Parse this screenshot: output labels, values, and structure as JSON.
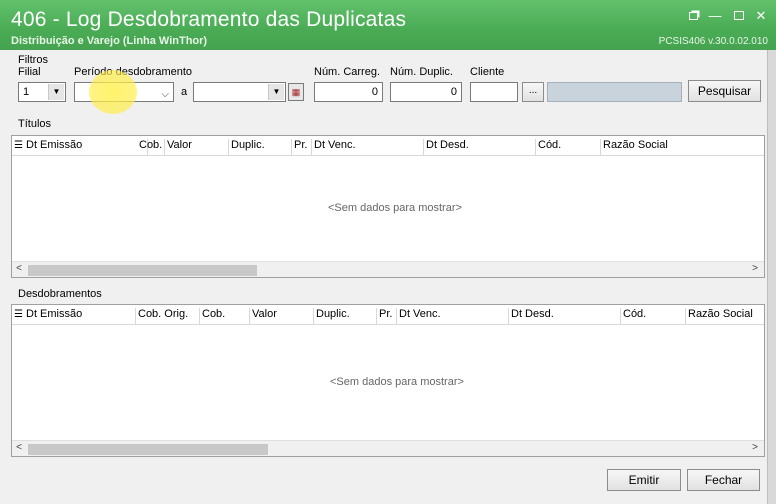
{
  "window": {
    "title": "406 - Log Desdobramento das Duplicatas",
    "subtitle": "Distribuição e Varejo (Linha WinThor)",
    "version": "PCSIS406  v.30.0.02.010",
    "controls": [
      "restore-icon",
      "minimize-icon",
      "maximize-icon",
      "close-icon"
    ]
  },
  "filters": {
    "group_label": "Filtros",
    "filial_label": "Filial",
    "filial_value": "1",
    "periodo_label": "Período desdobramento",
    "periodo_sep": "a",
    "periodo_start": "",
    "periodo_end": "",
    "num_carreg_label": "Núm. Carreg.",
    "num_carreg_value": "0",
    "num_duplic_label": "Núm. Duplic.",
    "num_duplic_value": "0",
    "cliente_label": "Cliente",
    "cliente_value": "",
    "cliente_lookup": "...",
    "cliente_name": "",
    "search_button": "Pesquisar"
  },
  "titulos": {
    "label": "Títulos",
    "columns": [
      "Dt Emissão",
      "Cob.",
      "Valor",
      "Duplic.",
      "Pr.",
      "Dt Venc.",
      "Dt Desd.",
      "Cód.",
      "Razão Social"
    ],
    "empty_message": "<Sem dados para mostrar>"
  },
  "desdobramentos": {
    "label": "Desdobramentos",
    "columns": [
      "Dt Emissão",
      "Cob. Orig.",
      "Cob.",
      "Valor",
      "Duplic.",
      "Pr.",
      "Dt Venc.",
      "Dt Desd.",
      "Cód.",
      "Razão Social"
    ],
    "empty_message": "<Sem dados para mostrar>"
  },
  "footer": {
    "emitir_button": "Emitir",
    "fechar_button": "Fechar"
  },
  "colors": {
    "titlebar": "#4aab55",
    "background": "#f0f0f0"
  }
}
